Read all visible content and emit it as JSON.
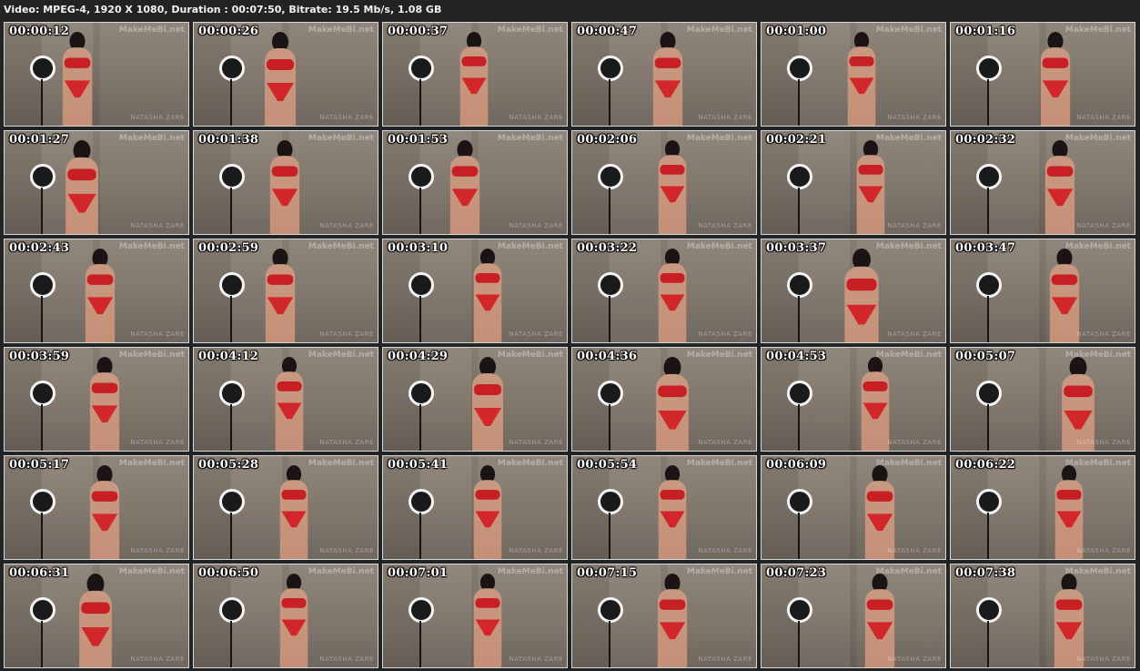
{
  "header": {
    "info": "Video: MPEG-4, 1920 X 1080, Duration : 00:07:50, Bitrate: 19.5 Mb/s, 1.08 GB"
  },
  "watermark": {
    "site": "MakeMeBi.net",
    "name": "NATASHA ZARE"
  },
  "colors": {
    "background": "#222325",
    "outfit": "#c81f24",
    "wall": "#8a8075"
  },
  "thumbnails": [
    {
      "time": "00:00:12"
    },
    {
      "time": "00:00:26"
    },
    {
      "time": "00:00:37"
    },
    {
      "time": "00:00:47"
    },
    {
      "time": "00:01:00"
    },
    {
      "time": "00:01:16"
    },
    {
      "time": "00:01:27"
    },
    {
      "time": "00:01:38"
    },
    {
      "time": "00:01:53"
    },
    {
      "time": "00:02:06"
    },
    {
      "time": "00:02:21"
    },
    {
      "time": "00:02:32"
    },
    {
      "time": "00:02:43"
    },
    {
      "time": "00:02:59"
    },
    {
      "time": "00:03:10"
    },
    {
      "time": "00:03:22"
    },
    {
      "time": "00:03:37"
    },
    {
      "time": "00:03:47"
    },
    {
      "time": "00:03:59"
    },
    {
      "time": "00:04:12"
    },
    {
      "time": "00:04:29"
    },
    {
      "time": "00:04:36"
    },
    {
      "time": "00:04:53"
    },
    {
      "time": "00:05:07"
    },
    {
      "time": "00:05:17"
    },
    {
      "time": "00:05:28"
    },
    {
      "time": "00:05:41"
    },
    {
      "time": "00:05:54"
    },
    {
      "time": "00:06:09"
    },
    {
      "time": "00:06:22"
    },
    {
      "time": "00:06:31"
    },
    {
      "time": "00:06:50"
    },
    {
      "time": "00:07:01"
    },
    {
      "time": "00:07:15"
    },
    {
      "time": "00:07:23"
    },
    {
      "time": "00:07:38"
    }
  ]
}
